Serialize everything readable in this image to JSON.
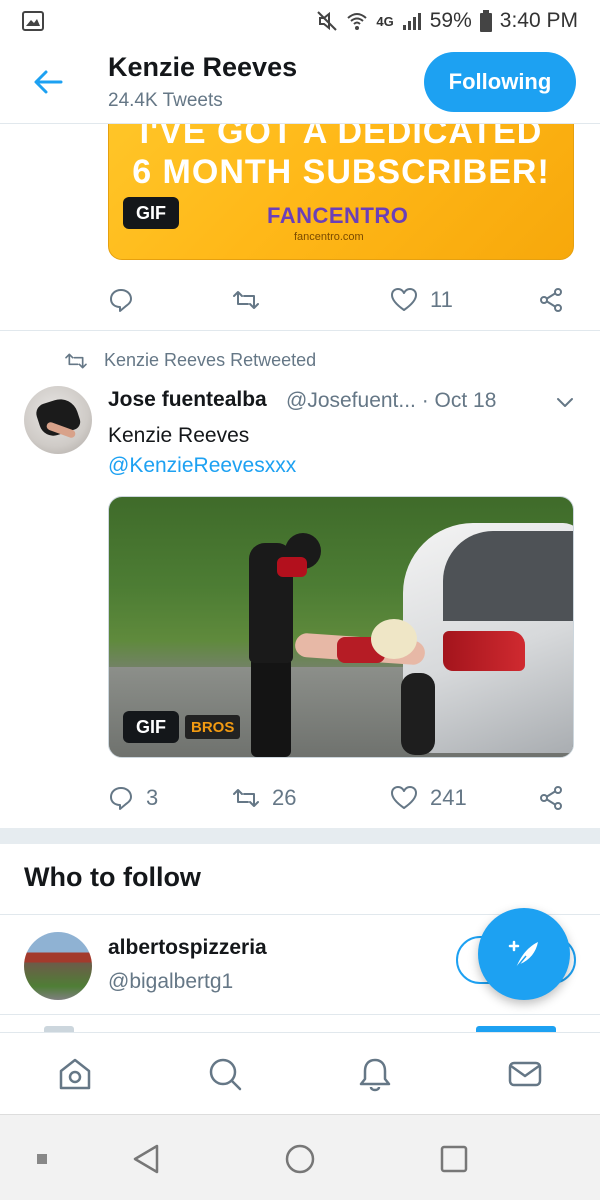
{
  "status_bar": {
    "network": "4G",
    "battery": "59%",
    "time": "3:40 PM"
  },
  "header": {
    "title": "Kenzie Reeves",
    "subtitle": "24.4K Tweets",
    "following_label": "Following"
  },
  "promo_tweet": {
    "line1": "I'VE GOT A DEDICATED",
    "line2": "6 MONTH SUBSCRIBER!",
    "brand": "FANCENTRO",
    "url": "fancentro.com",
    "gif_label": "GIF",
    "actions": {
      "reply": "",
      "retweet": "",
      "like": "11",
      "share": ""
    }
  },
  "retweet_tweet": {
    "retweet_label": "Kenzie Reeves Retweeted",
    "author_name": "Jose fuentealba",
    "author_handle_date": "@Josefuent... · Oct 18",
    "text_line1": "Kenzie Reeves",
    "text_mention": "@KenzieReevesxxx",
    "gif_label": "GIF",
    "media_brand": "BROS",
    "actions": {
      "reply": "3",
      "retweet": "26",
      "like": "241",
      "share": ""
    }
  },
  "who_to_follow": {
    "title": "Who to follow",
    "items": [
      {
        "name": "albertospizzeria",
        "handle": "@bigalbertg1"
      }
    ]
  },
  "colors": {
    "accent": "#1da1f2",
    "text_primary": "#14171a",
    "text_secondary": "#657786",
    "divider": "#e1e8ed"
  },
  "icons": {
    "back": "arrow-left-icon",
    "compose": "compose-tweet-icon",
    "tabs": [
      "home-icon",
      "search-icon",
      "notifications-icon",
      "messages-icon"
    ],
    "system_nav": [
      "recents-dot-icon",
      "back-triangle-icon",
      "home-circle-icon",
      "overview-square-icon"
    ]
  }
}
